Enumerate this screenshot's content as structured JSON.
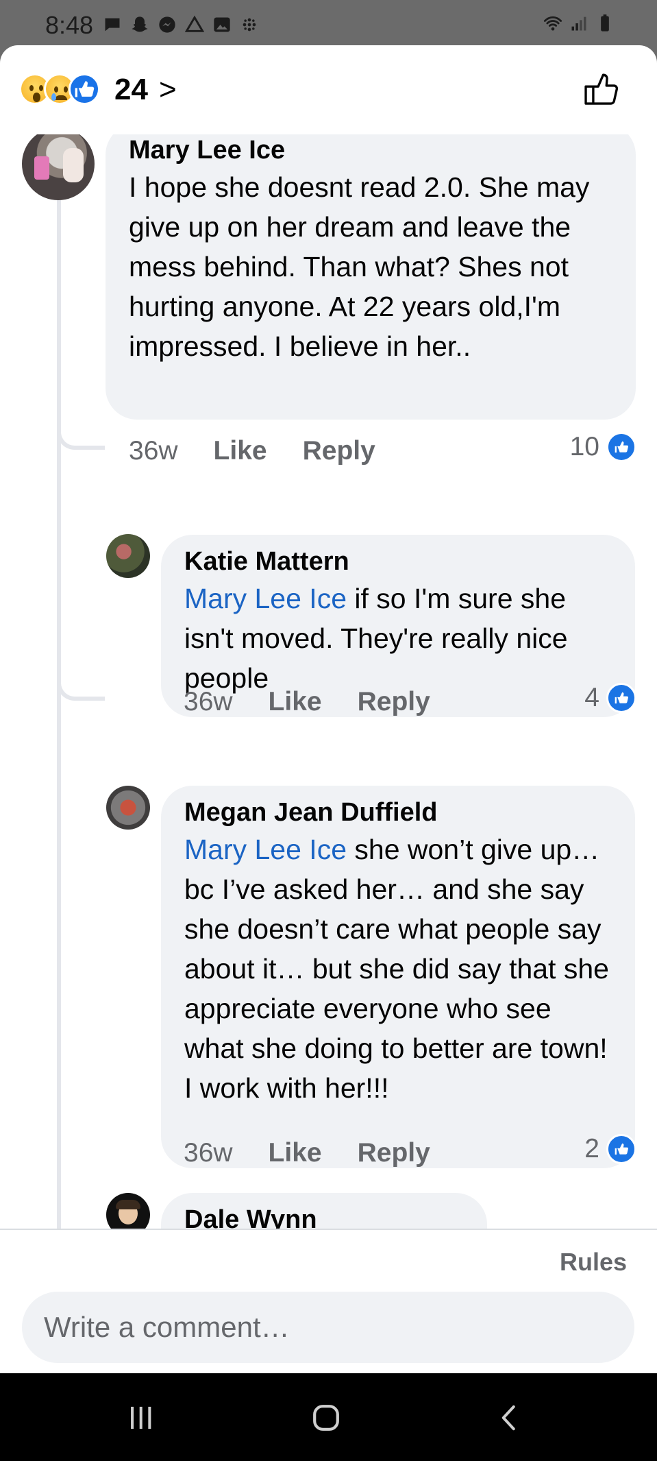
{
  "status_bar": {
    "time": "8:48"
  },
  "reactions": {
    "count": "24",
    "chevron": ">"
  },
  "comments": [
    {
      "name": "Mary Lee Ice",
      "mention": "",
      "text": "I hope she doesnt read 2.0. She may give up on her dream and leave the mess behind. Than what?  Shes not hurting anyone. At 22 years old,I'm impressed.  I believe in her..",
      "age": "36w",
      "like_label": "Like",
      "reply_label": "Reply",
      "likes": "10"
    },
    {
      "name": "Katie Mattern",
      "mention": "Mary Lee Ice",
      "text": " if so I'm sure she isn't moved. They're really nice people",
      "age": "36w",
      "like_label": "Like",
      "reply_label": "Reply",
      "likes": "4"
    },
    {
      "name": "Megan Jean Duffield",
      "mention": "Mary Lee Ice",
      "text": " she won’t give up… bc I’ve asked her… and she say she doesn’t care what people say about it… but she did say that she appreciate everyone who see what she doing to better are town! I work with her!!!",
      "age": "36w",
      "like_label": "Like",
      "reply_label": "Reply",
      "likes": "2"
    },
    {
      "name": "Dale Wynn"
    }
  ],
  "footer": {
    "rules_label": "Rules",
    "comment_placeholder": "Write a comment…"
  },
  "colors": {
    "mention": "#1b64c4",
    "like_blue": "#1b74e4",
    "bubble": "#f0f2f5",
    "meta_gray": "#65676b"
  },
  "icons": [
    "chat-bubble-icon",
    "snapchat-icon",
    "messenger-icon",
    "drive-icon",
    "gallery-icon",
    "slack-icon",
    "wifi-icon",
    "signal-icon",
    "battery-icon",
    "wow-reaction-icon",
    "sad-reaction-icon",
    "like-reaction-icon",
    "thumbs-up-outline-icon",
    "recent-apps-icon",
    "home-icon",
    "back-icon"
  ]
}
